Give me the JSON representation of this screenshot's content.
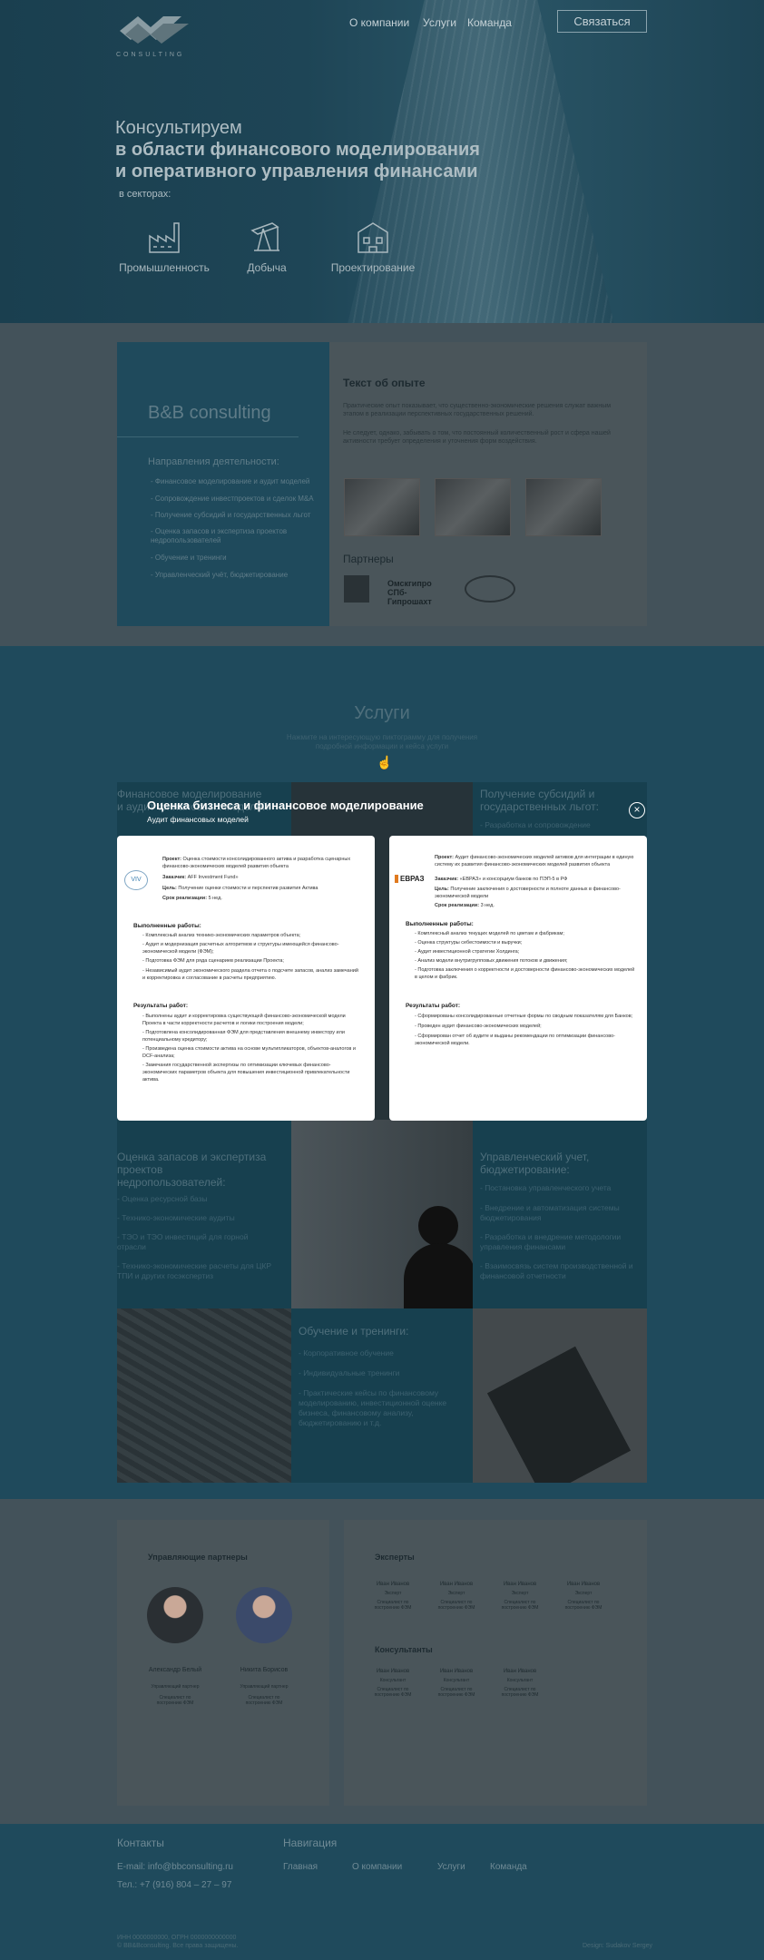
{
  "header": {
    "logo_top": "CONSULTING",
    "nav": [
      "О компании",
      "Услуги",
      "Команда"
    ],
    "contact_button": "Связаться"
  },
  "hero": {
    "line1": "Консультируем",
    "line2": "в области финансового моделирования",
    "line3": "и оперативного управления финансами",
    "sectors_label": "в секторах:",
    "sectors": [
      {
        "label": "Промышленность",
        "icon": "factory-icon"
      },
      {
        "label": "Добыча",
        "icon": "oil-pump-icon"
      },
      {
        "label": "Проектирование",
        "icon": "building-icon"
      }
    ]
  },
  "about": {
    "brand": "B&B consulting",
    "directions_title": "Направления деятельности:",
    "directions": [
      "- Финансовое моделирование и аудит моделей",
      "- Сопровождение инвестпроектов и сделок M&A",
      "- Получение субсидий и государственных льгот",
      "- Оценка запасов и экспертиза проектов недропользователей",
      "- Обучение и тренинги",
      "- Управленческий учёт, бюджетирование"
    ],
    "experience_title": "Текст об опыте",
    "experience_text1": "Практические опыт показывает, что существенно-экономические решения служат важным этапом в реализации перспективных государственных решений.",
    "experience_text2": "Не следует, однако, забывать о том, что постоянный количественный рост и сфера нашей активности требует определения и уточнения форм воздействия.",
    "partners_title": "Партнеры",
    "partners": [
      "",
      "Омскгипро СПб-Гипрошахт",
      ""
    ]
  },
  "services": {
    "title": "Услуги",
    "subtitle_line1": "Нажмите на интересующую пиктограмму для получения",
    "subtitle_line2": "подробной информации и кейса услуги",
    "tiles": [
      {
        "title_line1": "Финансовое моделирование",
        "title_line2": "и аудит финансовых моделей:",
        "text": ""
      },
      {
        "title_line1": "Получение субсидий и",
        "title_line2": "государственных льгот:",
        "text": "- Разработка и сопровождение"
      },
      {
        "title_line1": "Оценка запасов и экспертиза",
        "title_line2": "проектов",
        "title_line3": "недропользователей:",
        "items": [
          "- Оценка ресурсной базы",
          "- Технико-экономические аудиты",
          "- ТЭО и ТЭО инвестиций для горной отрасли",
          "- Технико-экономические расчеты для ЦКР ТПИ и других госэкспертиз"
        ]
      },
      {
        "title_line1": "Управленческий учет,",
        "title_line2": "бюджетирование:",
        "items": [
          "- Постановка управленческого учета",
          "- Внедрение и автоматизация системы бюджетирования",
          "- Разработка и внедрение методологии управления финансами",
          "- Взаимосвязь систем производственной и финансовой отчетности"
        ]
      },
      {
        "title_line1": "Обучение и тренинги:",
        "items": [
          "- Корпоративное обучение",
          "- Индивидуальные тренинги",
          "- Практические кейсы по финансовому моделированию, инвестиционной оценке бизнеса, финансовому анализу, бюджетированию и т.д."
        ]
      }
    ]
  },
  "modal": {
    "title": "Оценка бизнеса и финансовое моделирование",
    "subtitle": "Аудит финансовых моделей",
    "left": {
      "project_label": "Проект:",
      "project": "Оценка стоимости консолидированного актива и разработка сценарных финансово-экономических моделей развития объекта",
      "client_label": "Заказчик:",
      "client": "AFF Investment Fund»",
      "goal_label": "Цель:",
      "goal": "Получение оценки стоимости и перспектив развития Актива",
      "term_label": "Срок реализации:",
      "term": "5 нед.",
      "works_title": "Выполненные работы:",
      "works": [
        "- Комплексный анализ технико-экономических параметров объекта;",
        "- Аудит и модернизация расчетных алгоритмов и структуры имеющейся финансово-экономической модели (ФЭМ);",
        "- Подготовка ФЭМ для ряда сценариев реализации Проекта;",
        "- Независимый аудит экономического раздела отчета о подсчете запасов, анализ замечаний и корректировка и согласование в расчеты предприятию."
      ],
      "results_title": "Результаты работ:",
      "results": [
        "- Выполнены аудит и корректировка существующей финансово-экономической модели Проекта в части корректности расчетов и логики построения модели;",
        "- Подготовлена консолидированная ФЭМ для представления внешнему инвестору или потенциальному кредитору;",
        "- Произведена оценка стоимости актива на основе мультипликаторов, объектов-аналогов и DCF-анализа;",
        "- Замечания государственной экспертизы по оптимизации ключевых финансово-экономических параметров объекта для повышения инвестиционной привлекательности актива."
      ]
    },
    "right": {
      "logo_text": "ЕВРАЗ",
      "project_label": "Проект:",
      "project": "Аудит финансово-экономических моделей активов для интеграции в единую систему их развития финансово-экономических моделей развития объекта",
      "client_label": "Заказчик:",
      "client": "«ЕВРАЗ» и консорциум банков по ПЭП-5 в РФ",
      "goal_label": "Цель:",
      "goal": "Получение заключения о достоверности и полноте данных в финансово-экономической модели",
      "term_label": "Срок реализации:",
      "term": "3 нед.",
      "works_title": "Выполненные работы:",
      "works": [
        "- Комплексный анализ текущих моделей по цветам и фабрикам;",
        "- Оценка структуры себестоимости и выручки;",
        "- Аудит инвестиционной стратегии Холдинга;",
        "- Анализ модели внутригрупповых движения потоков и движения;",
        "- Подготовка заключения о корректности и достоверности финансово-экономических моделей в целом и фабрик."
      ],
      "results_title": "Результаты работ:",
      "results": [
        "- Сформированы консолидированные отчетные формы по сводным показателям для Банков;",
        "- Проведен аудит финансово-экономических моделей;",
        "- Сформирован отчет об аудите и выданы рекомендации по оптимизации финансово-экономической модели."
      ]
    }
  },
  "team": {
    "partners_title": "Управляющие партнеры",
    "partners": [
      {
        "name": "Александр Белый",
        "role": "Управляющий партнер",
        "desc": "Специалист по построению ФЭМ"
      },
      {
        "name": "Никита Борисов",
        "role": "Управляющий партнер",
        "desc": "Специалист по построению ФЭМ"
      }
    ],
    "experts_title": "Эксперты",
    "experts": [
      {
        "name": "Иван Иванов",
        "role": "Эксперт",
        "desc": "Специалист по построению ФЭМ"
      },
      {
        "name": "Иван Иванов",
        "role": "Эксперт",
        "desc": "Специалист по построению ФЭМ"
      },
      {
        "name": "Иван Иванов",
        "role": "Эксперт",
        "desc": "Специалист по построению ФЭМ"
      },
      {
        "name": "Иван Иванов",
        "role": "Эксперт",
        "desc": "Специалист по построению ФЭМ"
      }
    ],
    "consultants_title": "Консультанты",
    "consultants": [
      {
        "name": "Иван Иванов",
        "role": "Консультант",
        "desc": "Специалист по построению ФЭМ"
      },
      {
        "name": "Иван Иванов",
        "role": "Консультант",
        "desc": "Специалист по построению ФЭМ"
      },
      {
        "name": "Иван Иванов",
        "role": "Консультант",
        "desc": "Специалист по построению ФЭМ"
      }
    ]
  },
  "footer": {
    "contacts_title": "Контакты",
    "email": "E-mail: info@bbconsulting.ru",
    "phone": "Тел.: +7 (916) 804 – 27 – 97",
    "nav_title": "Навигация",
    "nav": [
      "Главная",
      "О компании",
      "Услуги",
      "Команда"
    ],
    "legal1": "ИНН 0000000000, ОГРН 0000000000000",
    "legal2": "© BB&Bconsulting. Все права защищены.",
    "credit": "Design: Sudakov Sergey"
  },
  "colors": {
    "teal": "#1f4a5c",
    "overlay": "#43525a",
    "white": "#ffffff"
  }
}
